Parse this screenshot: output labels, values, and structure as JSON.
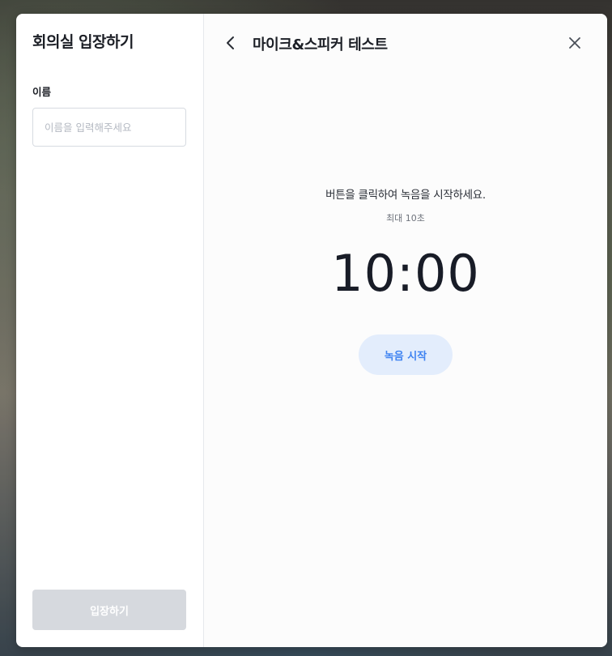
{
  "left_panel": {
    "title": "회의실 입장하기",
    "name_label": "이름",
    "name_input": {
      "value": "",
      "placeholder": "이름을 입력해주세요"
    },
    "enter_button_label": "입장하기"
  },
  "right_panel": {
    "title": "마이크&스피커 테스트",
    "back_icon": "chevron-left-icon",
    "close_icon": "close-icon",
    "instruction": "버튼을 클릭하여 녹음을 시작하세요.",
    "max_note": "최대 10초",
    "timer": "10:00",
    "record_button_label": "녹음 시작"
  },
  "colors": {
    "record_button_bg": "#e3edfc",
    "record_button_text": "#3f83f1",
    "enter_button_disabled": "#d6d9de"
  }
}
